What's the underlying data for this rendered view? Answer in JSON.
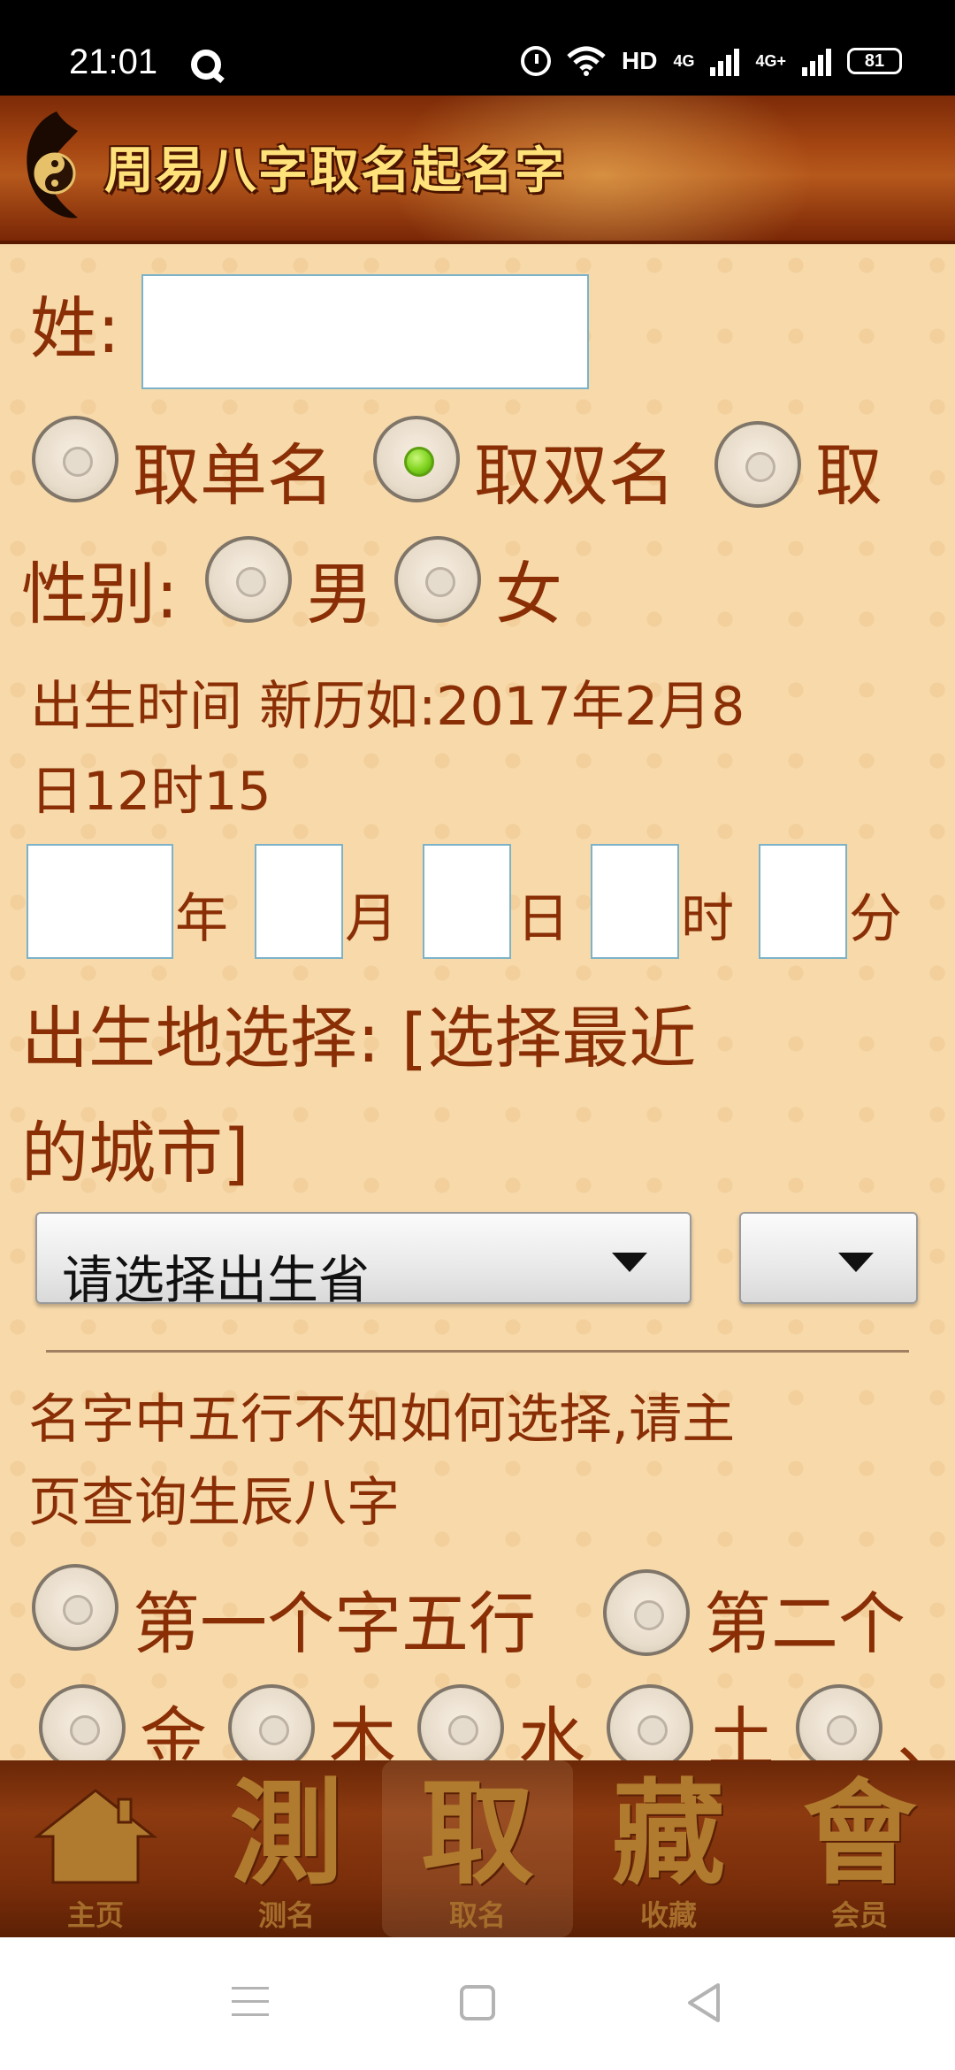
{
  "status_bar": {
    "time": "21:01",
    "network": "HD",
    "signal_1": "4G",
    "signal_2": "4G+",
    "battery": "81"
  },
  "header": {
    "title": "周易八字取名起名字"
  },
  "form": {
    "surname_label": "姓:",
    "surname_value": "",
    "name_type_options": [
      "取单名",
      "取双名",
      "取"
    ],
    "name_type_selected": "取双名",
    "gender_label": "性别:",
    "gender_options": [
      "男",
      "女"
    ],
    "birth_time_label": "出生时间 新历如:2017年2月8",
    "birth_time_label_line2": "日12时15",
    "date_units": [
      "年",
      "月",
      "日",
      "时",
      "分"
    ],
    "birthplace_label_line1": "出生地选择:  [选择最近",
    "birthplace_label_line2": "的城市]",
    "province_select": "请选择出生省",
    "city_select": "",
    "wuxing_hint_line1": "名字中五行不知如何选择,请主",
    "wuxing_hint_line2": "页查询生辰八字",
    "char_wuxing_options": [
      "第一个字五行",
      "第二个"
    ],
    "element_options": [
      "金",
      "木",
      "水",
      "土",
      "、"
    ]
  },
  "bottom_nav": [
    {
      "glyph": "",
      "label": "主页",
      "icon": "home-icon"
    },
    {
      "glyph": "測",
      "label": "测名"
    },
    {
      "glyph": "取",
      "label": "取名",
      "active": true
    },
    {
      "glyph": "藏",
      "label": "收藏"
    },
    {
      "glyph": "會",
      "label": "会员"
    }
  ],
  "colors": {
    "accent_text": "#8a2e05",
    "banner_text": "#ffe27a",
    "radio_checked": "#7fd31f"
  }
}
